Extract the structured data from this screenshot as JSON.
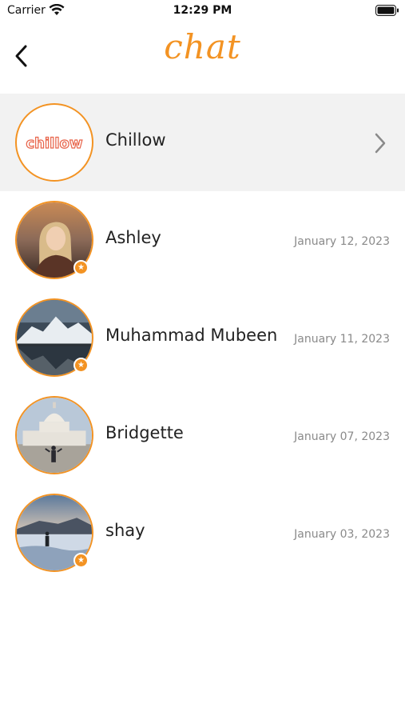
{
  "status_bar": {
    "carrier": "Carrier",
    "time": "12:29 PM",
    "icons": [
      "wifi-icon",
      "battery-icon"
    ]
  },
  "nav": {
    "title": "chat",
    "back_icon": "chevron-left-icon"
  },
  "colors": {
    "accent": "#f39323",
    "highlight_row": "#f2f2f2",
    "date_text": "#8a8a8a"
  },
  "chats": [
    {
      "name": "Chillow",
      "logo_text": "chillow",
      "date": "",
      "highlighted": true,
      "has_chevron": true,
      "badge": false
    },
    {
      "name": "Ashley",
      "date": "January 12, 2023",
      "badge": true
    },
    {
      "name": "Muhammad Mubeen",
      "date": "January 11, 2023",
      "badge": true
    },
    {
      "name": "Bridgette",
      "date": "January 07, 2023",
      "badge": false
    },
    {
      "name": "shay",
      "date": "January 03, 2023",
      "badge": true
    }
  ]
}
